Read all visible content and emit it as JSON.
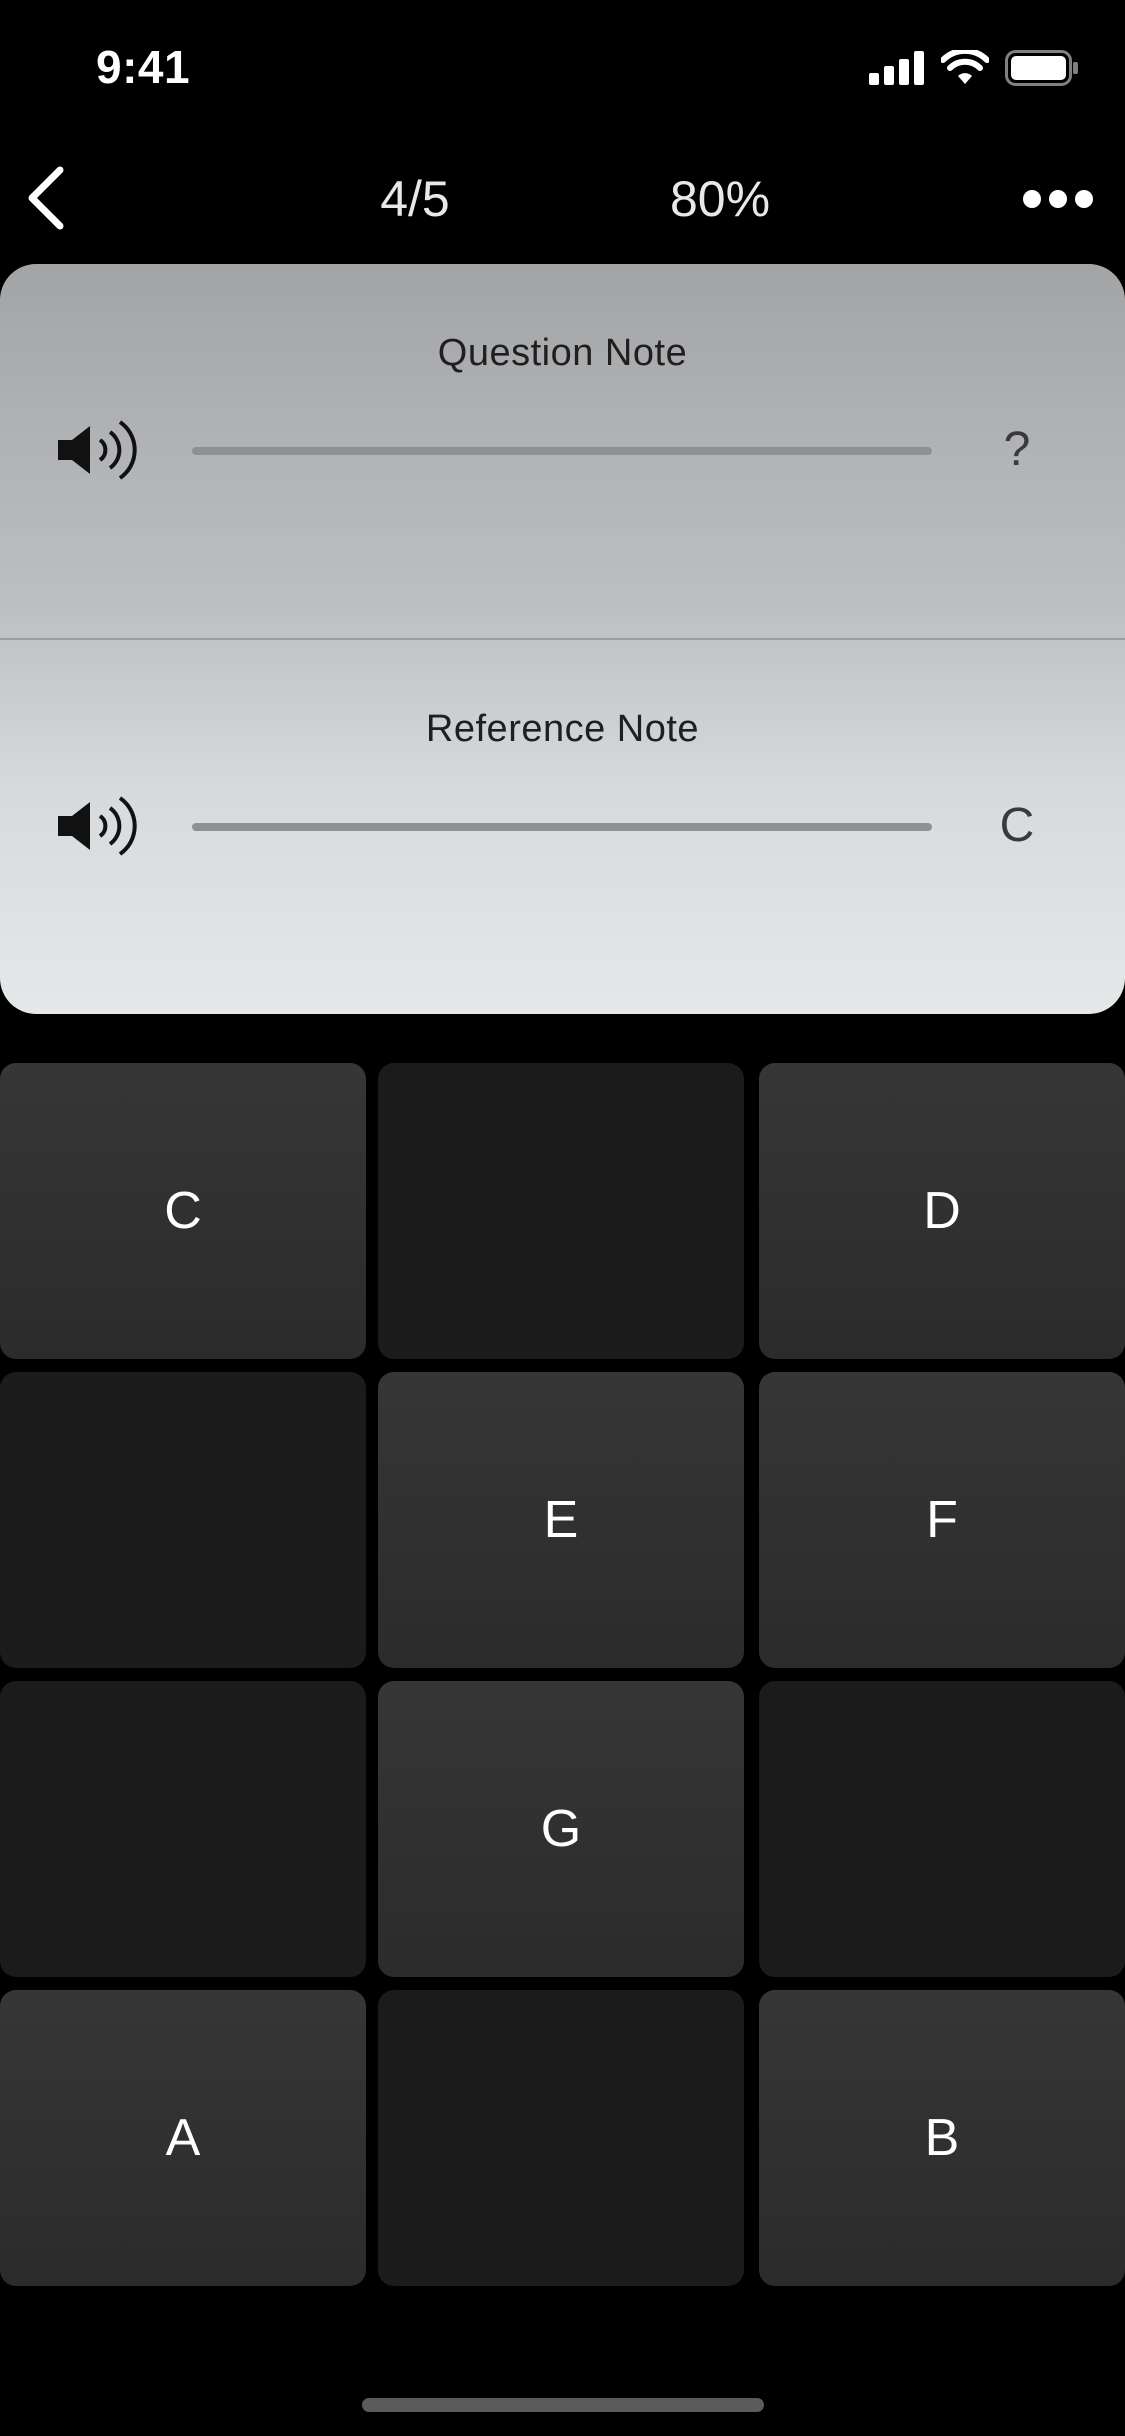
{
  "status_bar": {
    "time": "9:41",
    "icons": [
      "cellular-signal-icon",
      "wifi-icon",
      "battery-icon"
    ]
  },
  "nav": {
    "back_icon": "chevron-left-icon",
    "progress": "4/5",
    "score": "80%",
    "more_icon": "ellipsis-icon"
  },
  "question_panel": {
    "title": "Question Note",
    "icon": "speaker-icon",
    "value": "?"
  },
  "reference_panel": {
    "title": "Reference Note",
    "icon": "speaker-icon",
    "value": "C"
  },
  "answer_grid": {
    "cells": [
      {
        "label": "C",
        "enabled": true
      },
      {
        "label": "",
        "enabled": false
      },
      {
        "label": "D",
        "enabled": true
      },
      {
        "label": "",
        "enabled": false
      },
      {
        "label": "E",
        "enabled": true
      },
      {
        "label": "F",
        "enabled": true
      },
      {
        "label": "",
        "enabled": false
      },
      {
        "label": "G",
        "enabled": true
      },
      {
        "label": "",
        "enabled": false
      },
      {
        "label": "A",
        "enabled": true
      },
      {
        "label": "",
        "enabled": false
      },
      {
        "label": "B",
        "enabled": true
      }
    ]
  },
  "colors": {
    "background": "#000000",
    "active_cell": "#303030",
    "empty_cell": "#1b1b1b",
    "card_top": "#a3a4a6",
    "card_bottom": "#e5e8e9"
  }
}
